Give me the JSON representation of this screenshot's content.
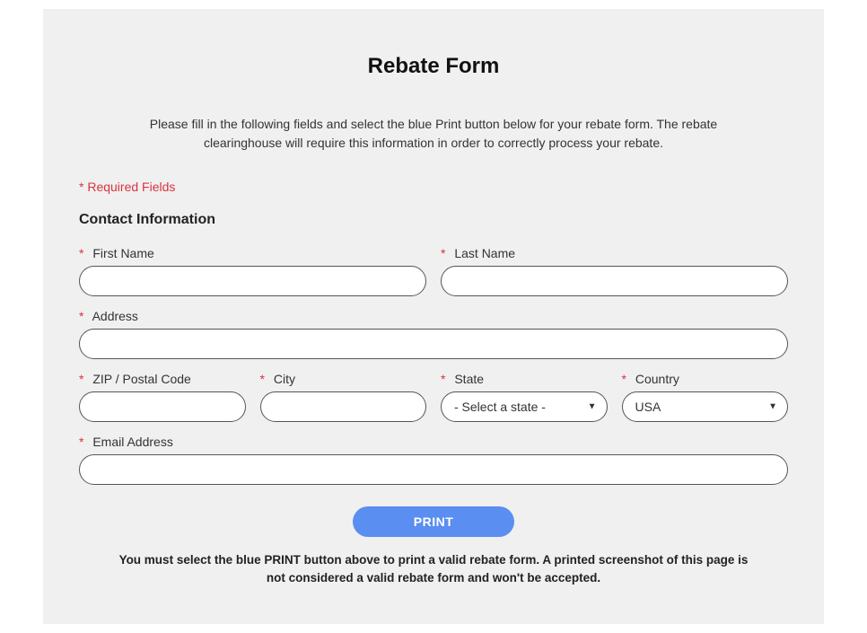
{
  "title": "Rebate Form",
  "instructions": "Please fill in the following fields and select the blue Print button below for your rebate form. The rebate clearinghouse will require this information in order to correctly process your rebate.",
  "required_note": "* Required Fields",
  "section_title": "Contact Information",
  "fields": {
    "first_name": {
      "label": "First Name",
      "value": ""
    },
    "last_name": {
      "label": "Last Name",
      "value": ""
    },
    "address": {
      "label": "Address",
      "value": ""
    },
    "zip": {
      "label": "ZIP / Postal Code",
      "value": ""
    },
    "city": {
      "label": "City",
      "value": ""
    },
    "state": {
      "label": "State",
      "selected": "- Select a state -"
    },
    "country": {
      "label": "Country",
      "selected": "USA"
    },
    "email": {
      "label": "Email Address",
      "value": ""
    }
  },
  "print_button": "PRINT",
  "disclaimer": "You must select the blue PRINT button above to print a valid rebate form. A printed screenshot of this page is not considered a valid rebate form and won't be accepted."
}
